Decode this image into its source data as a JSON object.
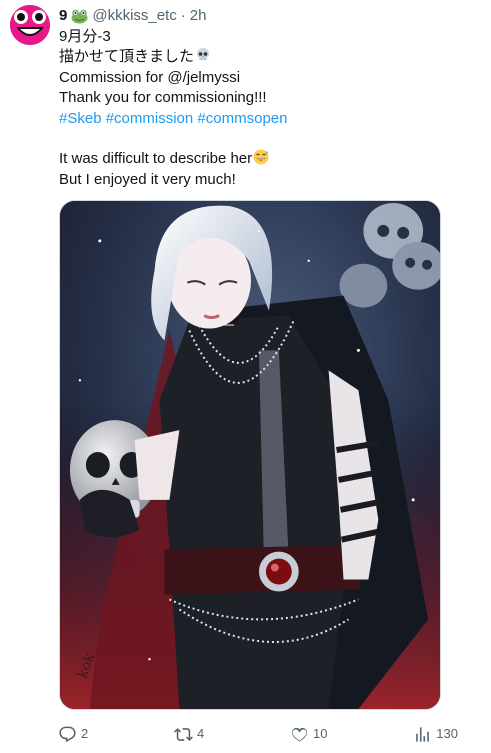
{
  "author": {
    "display_name": "9",
    "handle": "@kkkiss_etc",
    "separator": "·",
    "time": "2h"
  },
  "tweet": {
    "line1": "9月分-3",
    "line2": "描かせて頂きました",
    "line3": "Commission for @/jelmyssi",
    "line4": "Thank you for commissioning!!!",
    "hashtags": [
      "#Skeb",
      "#commission",
      "#commsopen"
    ],
    "line6": "It was difficult to describe her",
    "line7": "But I enjoyed it very much!"
  },
  "icons": {
    "name_emoji": "frog-emoji",
    "line2_emoji": "skull-emoji",
    "line6_emoji": "sweat-smile-emoji"
  },
  "media": {
    "signature": "kok",
    "alt": "Illustration of a white-haired woman in black holding a skull"
  },
  "actions": {
    "replies": "2",
    "reposts": "4",
    "likes": "10",
    "views": "130"
  },
  "colors": {
    "link": "#1d9bf0",
    "secondary": "#536471",
    "avatar_bg": "#e8188a"
  }
}
